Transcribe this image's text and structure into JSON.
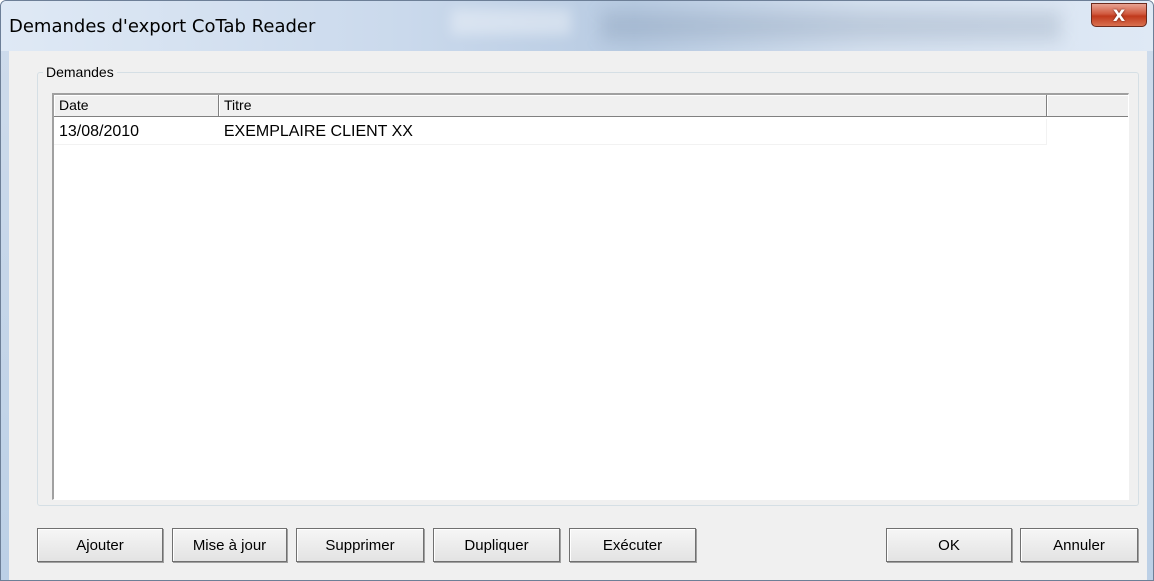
{
  "window": {
    "title": "Demandes d'export CoTab Reader",
    "close_glyph": "X"
  },
  "group": {
    "label": "Demandes"
  },
  "table": {
    "columns": [
      "Date",
      "Titre"
    ],
    "rows": [
      {
        "date": "13/08/2010",
        "titre": "EXEMPLAIRE CLIENT XX"
      }
    ]
  },
  "buttons": {
    "ajouter": "Ajouter",
    "mise_a_jour": "Mise à jour",
    "supprimer": "Supprimer",
    "dupliquer": "Dupliquer",
    "executer": "Exécuter",
    "ok": "OK",
    "annuler": "Annuler"
  },
  "colors": {
    "close_button": "#c0391c",
    "dialog_face": "#f0f0f0",
    "list_background": "#ffffff"
  }
}
